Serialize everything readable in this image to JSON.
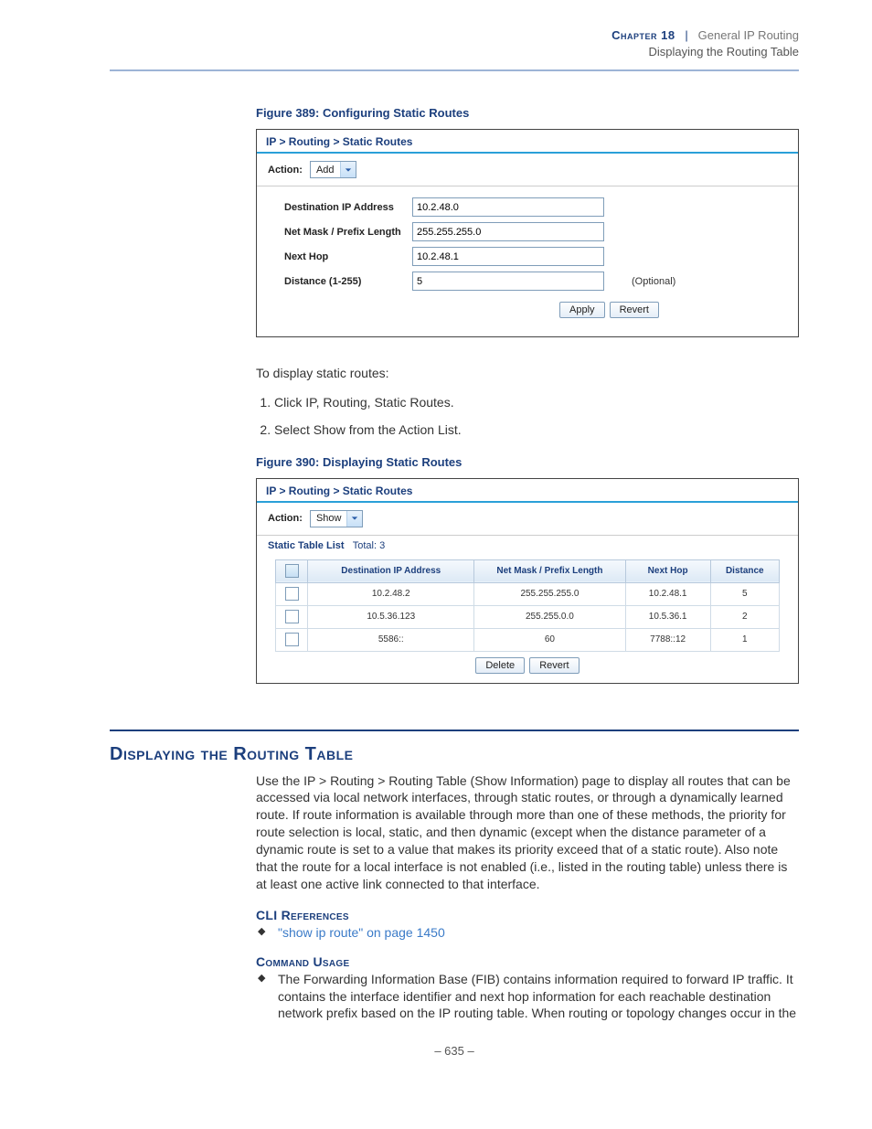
{
  "header": {
    "chapter_label": "Chapter 18",
    "separator": "|",
    "chapter_title": "General IP Routing",
    "subtitle": "Displaying the Routing Table"
  },
  "figure389": {
    "caption": "Figure 389:  Configuring Static Routes",
    "breadcrumb": "IP > Routing > Static Routes",
    "action_label": "Action:",
    "action_value": "Add",
    "fields": {
      "dest_label": "Destination IP Address",
      "dest_value": "10.2.48.0",
      "mask_label": "Net Mask / Prefix Length",
      "mask_value": "255.255.255.0",
      "nexthop_label": "Next Hop",
      "nexthop_value": "10.2.48.1",
      "distance_label": "Distance (1-255)",
      "distance_value": "5",
      "optional": "(Optional)"
    },
    "buttons": {
      "apply": "Apply",
      "revert": "Revert"
    }
  },
  "intro_text": "To display static routes:",
  "steps": {
    "s1": "Click IP, Routing, Static Routes.",
    "s2": "Select Show from the Action List."
  },
  "figure390": {
    "caption": "Figure 390:  Displaying Static Routes",
    "breadcrumb": "IP > Routing > Static Routes",
    "action_label": "Action:",
    "action_value": "Show",
    "list_title": "Static Table List",
    "total_label": "Total: 3",
    "columns": {
      "c1": "Destination IP Address",
      "c2": "Net Mask / Prefix Length",
      "c3": "Next Hop",
      "c4": "Distance"
    },
    "rows": [
      {
        "dest": "10.2.48.2",
        "mask": "255.255.255.0",
        "nh": "10.2.48.1",
        "dist": "5"
      },
      {
        "dest": "10.5.36.123",
        "mask": "255.255.0.0",
        "nh": "10.5.36.1",
        "dist": "2"
      },
      {
        "dest": "5586::",
        "mask": "60",
        "nh": "7788::12",
        "dist": "1"
      }
    ],
    "buttons": {
      "delete": "Delete",
      "revert": "Revert"
    }
  },
  "section2": {
    "heading": "Displaying the Routing Table",
    "paragraph": "Use the IP > Routing > Routing Table (Show Information) page to display all routes that can be accessed via local network interfaces, through static routes, or through a dynamically learned route. If route information is available through more than one of these methods, the priority for route selection is local, static, and then dynamic (except when the distance parameter of a dynamic route is set to a value that makes its priority exceed that of a static route). Also note that the route for a local interface is not enabled (i.e., listed in the routing table) unless there is at least one active link connected to that interface.",
    "cli_head": "CLI References",
    "cli_link": "\"show ip route\" on page 1450",
    "cmd_head": "Command Usage",
    "cmd_text": "The Forwarding Information Base (FIB) contains information required to forward IP traffic. It contains the interface identifier and next hop information for each reachable destination network prefix based on the IP routing table. When routing or topology changes occur in the"
  },
  "footer": {
    "page": "–  635  –"
  }
}
